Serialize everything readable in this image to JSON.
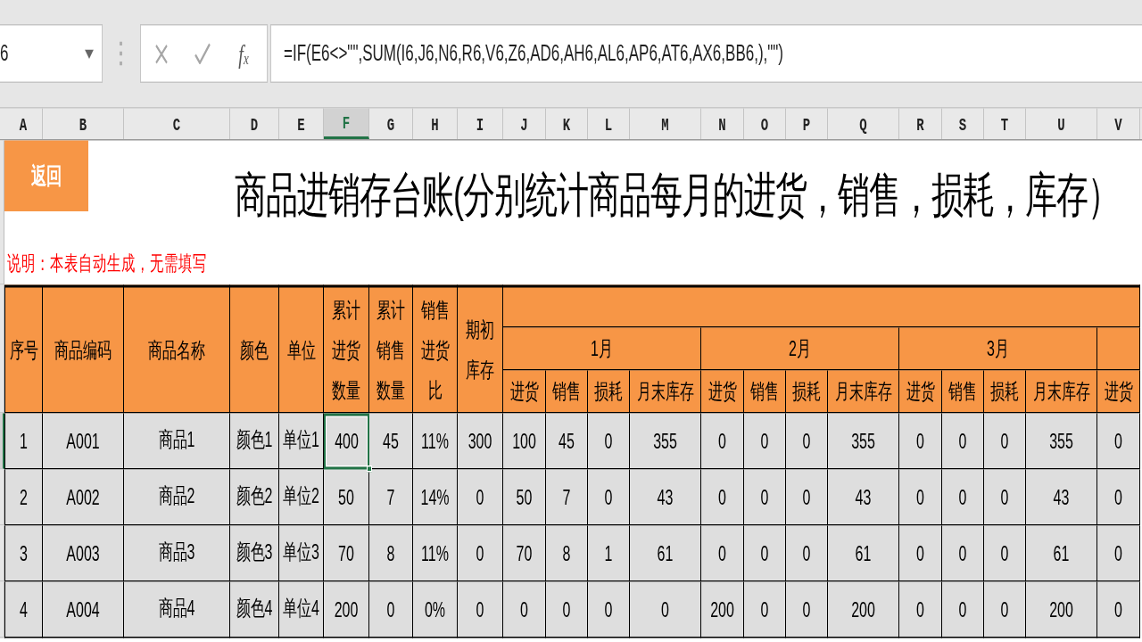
{
  "formula_bar": {
    "name_box": "6",
    "cancel_button": {
      "disabled": true
    },
    "enter_button": {
      "disabled": true
    },
    "function_button": "f$_{x}$",
    "formula": "=IF(E6<>\"\",SUM(I6,J6,N6,R6,V6,Z6,AD6,AH6,AL6,AP6,AT6,AX6,BB6,),\"\")"
  },
  "column_letters": [
    {
      "label": "A",
      "selected": false
    },
    {
      "label": "B",
      "selected": false
    },
    {
      "label": "C",
      "selected": false
    },
    {
      "label": "D",
      "selected": false
    },
    {
      "label": "E",
      "selected": false
    },
    {
      "label": "F",
      "selected": true
    },
    {
      "label": "G",
      "selected": false
    },
    {
      "label": "H",
      "selected": false
    },
    {
      "label": "I",
      "selected": false
    },
    {
      "label": "J",
      "selected": false
    },
    {
      "label": "K",
      "selected": false
    },
    {
      "label": "L",
      "selected": false
    },
    {
      "label": "M",
      "selected": false
    },
    {
      "label": "N",
      "selected": false
    },
    {
      "label": "O",
      "selected": false
    },
    {
      "label": "P",
      "selected": false
    },
    {
      "label": "Q",
      "selected": false
    },
    {
      "label": "R",
      "selected": false
    },
    {
      "label": "S",
      "selected": false
    },
    {
      "label": "T",
      "selected": false
    },
    {
      "label": "U",
      "selected": false
    },
    {
      "label": "V",
      "selected": false
    }
  ],
  "return_button": "返回",
  "title": "商品进销存台账(分别统计商品每月的进货，销售，损耗，库存）",
  "note": "说明：本表自动生成，无需填写",
  "table": {
    "fixed_columns": [
      "序号",
      "商品编码",
      "商品名称",
      "颜色",
      "单位",
      "累计进货数量",
      "累计销售数量",
      "销售进货比",
      "期初库存"
    ],
    "months": [
      {
        "label": "1月",
        "columns": [
          "进货",
          "销售",
          "损耗",
          "月末库存"
        ]
      },
      {
        "label": "2月",
        "columns": [
          "进货",
          "销售",
          "损耗",
          "月末库存"
        ]
      },
      {
        "label": "3月",
        "columns": [
          "进货",
          "销售",
          "损耗",
          "月末库存"
        ]
      },
      {
        "columns": [
          "进货"
        ]
      }
    ],
    "rows": [
      {
        "selected": true,
        "cells": [
          "1",
          "A001",
          "商品1",
          "颜色1",
          "单位1",
          "400",
          "45",
          "11%",
          "300",
          "100",
          "45",
          "0",
          "355",
          "0",
          "0",
          "0",
          "355",
          "0",
          "0",
          "0",
          "355",
          "0"
        ]
      },
      {
        "selected": false,
        "cells": [
          "2",
          "A002",
          "商品2",
          "颜色2",
          "单位2",
          "50",
          "7",
          "14%",
          "0",
          "50",
          "7",
          "0",
          "43",
          "0",
          "0",
          "0",
          "43",
          "0",
          "0",
          "0",
          "43",
          "0"
        ]
      },
      {
        "selected": false,
        "cells": [
          "3",
          "A003",
          "商品3",
          "颜色3",
          "单位3",
          "70",
          "8",
          "11%",
          "0",
          "70",
          "8",
          "1",
          "61",
          "0",
          "0",
          "0",
          "61",
          "0",
          "0",
          "0",
          "61",
          "0"
        ]
      },
      {
        "selected": false,
        "cells": [
          "4",
          "A004",
          "商品4",
          "颜色4",
          "单位4",
          "200",
          "0",
          "0%",
          "0",
          "0",
          "0",
          "0",
          "0",
          "200",
          "0",
          "0",
          "200",
          "0",
          "0",
          "0",
          "200",
          "0"
        ]
      }
    ]
  }
}
